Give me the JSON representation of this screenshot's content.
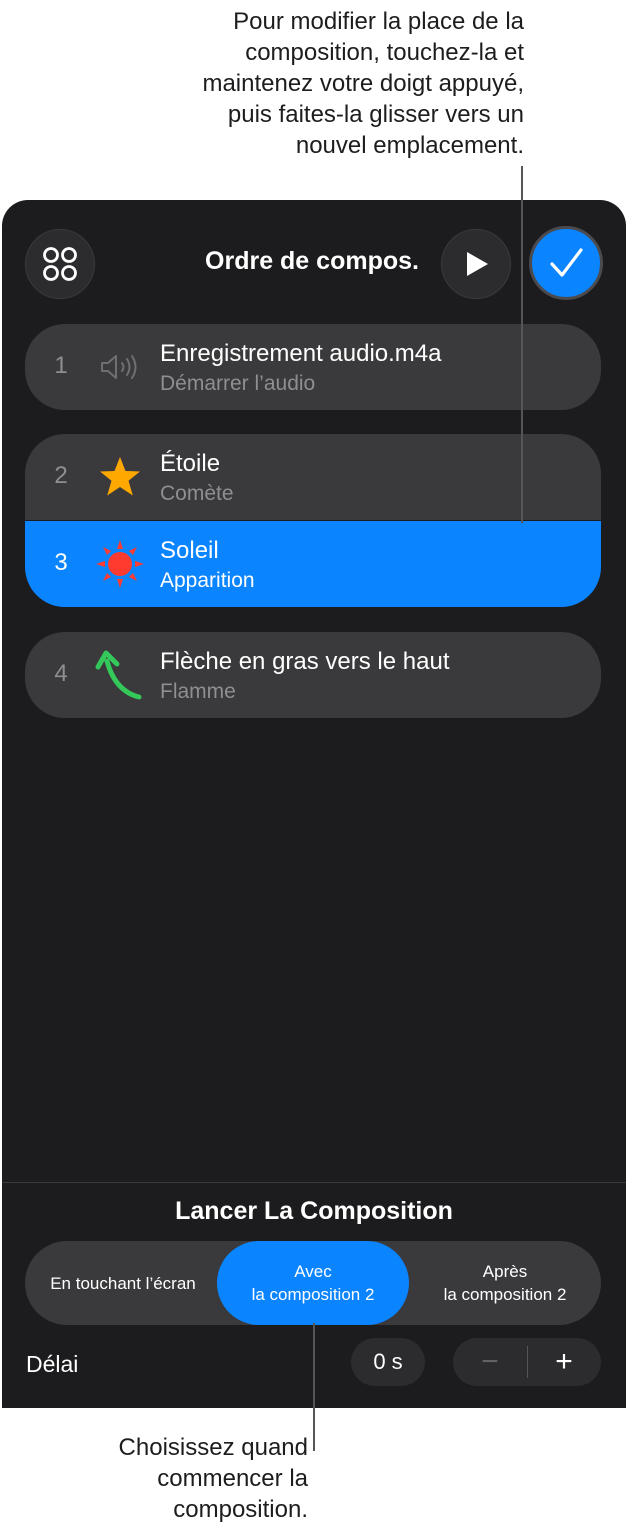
{
  "callouts": {
    "top_lines": [
      "Pour modifier la place de la",
      "composition, touchez-la et",
      "maintenez votre doigt appuyé,",
      "puis faites-la glisser vers un",
      "nouvel emplacement."
    ],
    "bottom_lines": [
      "Choisissez quand",
      "commencer la",
      "composition."
    ]
  },
  "header": {
    "title": "Ordre de compos.",
    "left_icon": "grid-icon",
    "play_icon": "play-icon",
    "done_icon": "checkmark-icon"
  },
  "builds": [
    {
      "number": "1",
      "name": "Enregistrement audio.m4a",
      "effect": "Démarrer l’audio",
      "icon": "speaker-icon"
    },
    {
      "number": "2",
      "name": "Étoile",
      "effect": "Comète",
      "icon": "star-icon"
    },
    {
      "number": "3",
      "name": "Soleil",
      "effect": "Apparition",
      "icon": "sun-icon",
      "selected": true
    },
    {
      "number": "4",
      "name": "Flèche en gras vers le haut",
      "effect": "Flamme",
      "icon": "arrow-icon"
    }
  ],
  "start": {
    "title": "Lancer La Composition",
    "options": [
      {
        "line1": "En touchant l’écran",
        "line2": ""
      },
      {
        "line1": "Avec",
        "line2": "la composition 2"
      },
      {
        "line1": "Après",
        "line2": "la composition 2"
      }
    ],
    "selected_index": 1
  },
  "delay": {
    "label": "Délai",
    "value": "0 s",
    "minus": "−",
    "plus": "+"
  },
  "colors": {
    "accent": "#0a84ff",
    "panel_bg": "#1c1c1e",
    "row_bg": "#3a3a3c",
    "star": "#ffa800",
    "sun": "#ff3b30",
    "arrow": "#34c759"
  }
}
